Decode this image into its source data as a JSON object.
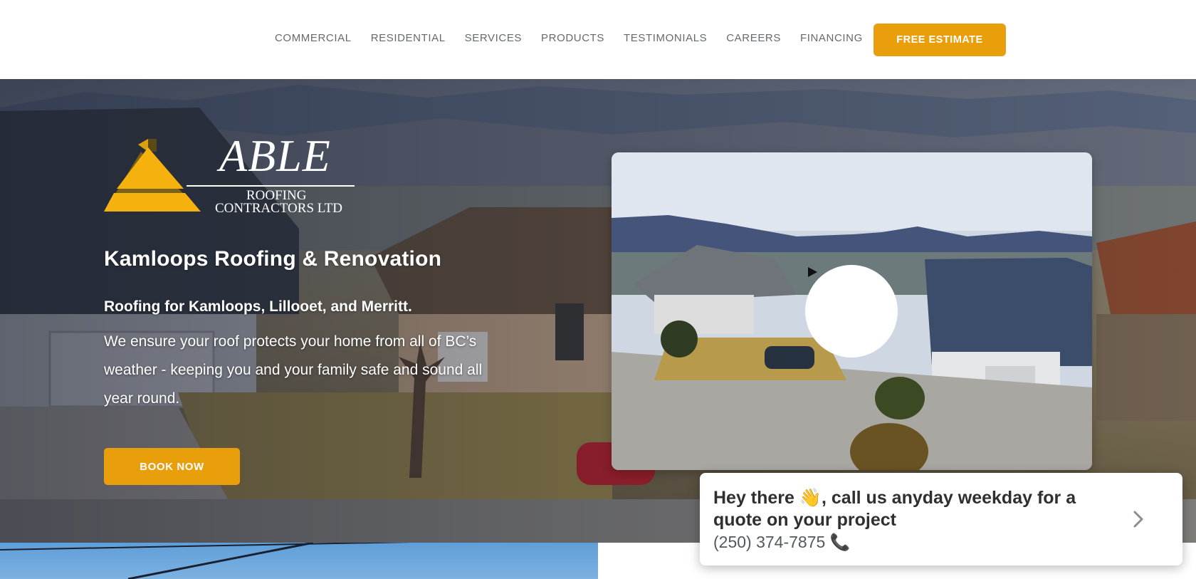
{
  "header": {
    "nav": [
      "COMMERCIAL",
      "RESIDENTIAL",
      "SERVICES",
      "PRODUCTS",
      "TESTIMONIALS",
      "CAREERS",
      "FINANCING"
    ],
    "cta_label": "FREE ESTIMATE"
  },
  "logo": {
    "wordmark": "ABLE",
    "line1": "ROOFING",
    "line2": "CONTRACTORS LTD",
    "icon": "roof-triangle-logo"
  },
  "hero": {
    "title": "Kamloops Roofing & Renovation",
    "lead": "Roofing for Kamloops, Lillooet, and Merritt.",
    "body": "We ensure your roof protects your home from all of BC’s weather - keeping you and your family safe and sound all year round.",
    "button_label": "BOOK NOW",
    "video_icon": "play-icon"
  },
  "chat": {
    "message": "Hey there 👋, call us anyday weekday for a quote on your project",
    "phone": "(250) 374-7875 📞",
    "arrow_icon": "chevron-right-icon"
  },
  "colors": {
    "accent": "#e99e0c",
    "logo_yellow": "#f5b20f",
    "nav_text": "#666a6e"
  }
}
